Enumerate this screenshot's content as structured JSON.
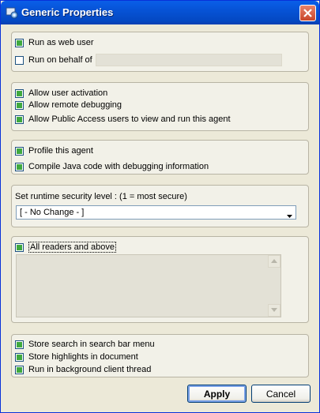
{
  "window": {
    "title": "Generic Properties"
  },
  "group1": {
    "run_as_web_user": {
      "label": "Run as web user",
      "checked": true
    },
    "run_on_behalf": {
      "label": "Run on behalf of",
      "checked": false,
      "value": ""
    }
  },
  "group2": {
    "items": [
      {
        "label": "Allow user activation",
        "checked": true
      },
      {
        "label": "Allow remote debugging",
        "checked": true
      },
      {
        "label": "Allow Public Access users to view and run this agent",
        "checked": true
      }
    ]
  },
  "group3": {
    "items": [
      {
        "label": "Profile this agent",
        "checked": true
      },
      {
        "label": "Compile Java code with debugging  information",
        "checked": true
      }
    ]
  },
  "security": {
    "label": "Set runtime security level : (1 =  most secure)",
    "selected": "[ - No Change - ]"
  },
  "readers": {
    "label": "All readers and above",
    "checked": true
  },
  "group5": {
    "items": [
      {
        "label": "Store search in search bar menu",
        "checked": true
      },
      {
        "label": "Store highlights in document",
        "checked": true
      },
      {
        "label": "Run in background client thread",
        "checked": true
      }
    ]
  },
  "buttons": {
    "apply": "Apply",
    "cancel": "Cancel"
  }
}
